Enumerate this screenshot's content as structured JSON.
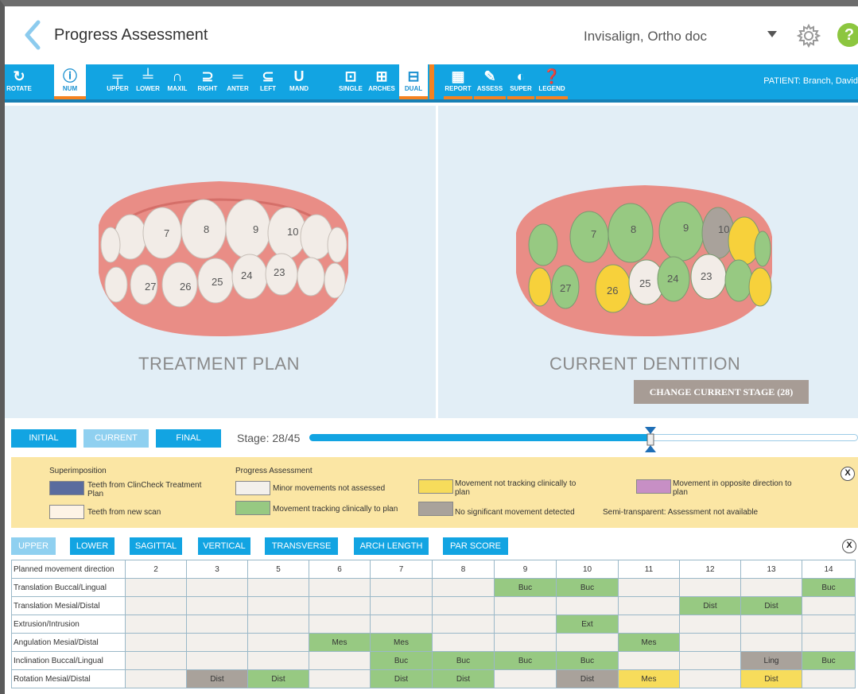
{
  "header": {
    "title": "Progress Assessment",
    "doctor": "Invisalign, Ortho doc"
  },
  "toolbar": {
    "rotate": "ROTATE",
    "num": "NUM",
    "upper": "UPPER",
    "lower": "LOWER",
    "maxil": "MAXIL",
    "right": "RIGHT",
    "anter": "ANTER",
    "left": "LEFT",
    "mand": "MAND",
    "single": "SINGLE",
    "arches": "ARCHES",
    "dual": "DUAL",
    "report": "REPORT",
    "assess": "ASSESS",
    "super": "SUPER",
    "legend": "LEGEND",
    "patient": "PATIENT: Branch, David"
  },
  "viewers": {
    "left_label": "TREATMENT PLAN",
    "right_label": "CURRENT DENTITION",
    "change_stage": "CHANGE CURRENT STAGE (28)",
    "left_numbers": [
      "7",
      "8",
      "9",
      "10",
      "26",
      "25",
      "24",
      "23",
      "27"
    ],
    "right_numbers": [
      "7",
      "8",
      "9",
      "10",
      "26",
      "25",
      "24",
      "23",
      "27"
    ]
  },
  "stage": {
    "initial": "INITIAL",
    "current": "CURRENT",
    "final": "FINAL",
    "label": "Stage:  28/45",
    "current_stage": 28,
    "total_stages": 45
  },
  "legend": {
    "superimposition": "Superimposition",
    "clincheck": "Teeth from ClinCheck Treatment Plan",
    "new_scan": "Teeth from new scan",
    "progress": "Progress Assessment",
    "minor": "Minor movements not assessed",
    "tracking": "Movement tracking clinically to plan",
    "not_tracking": "Movement not tracking clinically to plan",
    "no_sig": "No significant movement detected",
    "opposite": "Movement in opposite direction to plan",
    "semi": "Semi-transparent:  Assessment not available",
    "close": "X",
    "colors": {
      "clincheck": "#5a6c9e",
      "new_scan": "#fdf3e6",
      "minor": "#f3f0ec",
      "tracking": "#97c982",
      "not_tracking": "#f7dc5b",
      "no_sig": "#a9a29b",
      "opposite": "#c78fc5"
    }
  },
  "tabs": [
    "UPPER",
    "LOWER",
    "SAGITTAL",
    "VERTICAL",
    "TRANSVERSE",
    "ARCH LENGTH",
    "PAR SCORE"
  ],
  "table": {
    "header": [
      "Planned movement direction",
      "2",
      "3",
      "5",
      "6",
      "7",
      "8",
      "9",
      "10",
      "11",
      "12",
      "13",
      "14"
    ],
    "rows": [
      {
        "label": "Translation Buccal/Lingual",
        "cells": [
          "",
          "",
          "",
          "",
          "",
          "",
          "Buc",
          "Buc",
          "",
          "",
          "",
          "Buc"
        ],
        "status": [
          "",
          "",
          "",
          "",
          "",
          "",
          "g",
          "g",
          "",
          "",
          "",
          "g"
        ]
      },
      {
        "label": "Translation Mesial/Distal",
        "cells": [
          "",
          "",
          "",
          "",
          "",
          "",
          "",
          "",
          "",
          "Dist",
          "Dist",
          ""
        ],
        "status": [
          "",
          "",
          "",
          "",
          "",
          "",
          "",
          "",
          "",
          "g",
          "g",
          ""
        ]
      },
      {
        "label": "Extrusion/Intrusion",
        "cells": [
          "",
          "",
          "",
          "",
          "",
          "",
          "",
          "Ext",
          "",
          "",
          "",
          ""
        ],
        "status": [
          "",
          "",
          "",
          "",
          "",
          "",
          "",
          "g",
          "",
          "",
          "",
          ""
        ]
      },
      {
        "label": "Angulation Mesial/Distal",
        "cells": [
          "",
          "",
          "",
          "Mes",
          "Mes",
          "",
          "",
          "",
          "Mes",
          "",
          "",
          ""
        ],
        "status": [
          "",
          "",
          "",
          "g",
          "g",
          "",
          "",
          "",
          "g",
          "",
          "",
          ""
        ]
      },
      {
        "label": "Inclination Buccal/Lingual",
        "cells": [
          "",
          "",
          "",
          "",
          "Buc",
          "Buc",
          "Buc",
          "Buc",
          "",
          "",
          "Ling",
          "Buc"
        ],
        "status": [
          "",
          "",
          "",
          "",
          "g",
          "g",
          "g",
          "g",
          "",
          "",
          "gr",
          "g"
        ]
      },
      {
        "label": "Rotation Mesial/Distal",
        "cells": [
          "",
          "Dist",
          "Dist",
          "",
          "Dist",
          "Dist",
          "",
          "Dist",
          "Mes",
          "",
          "Dist",
          ""
        ],
        "status": [
          "",
          "gr",
          "g",
          "",
          "g",
          "g",
          "",
          "gr",
          "y",
          "",
          "y",
          ""
        ]
      }
    ]
  },
  "close": "X"
}
